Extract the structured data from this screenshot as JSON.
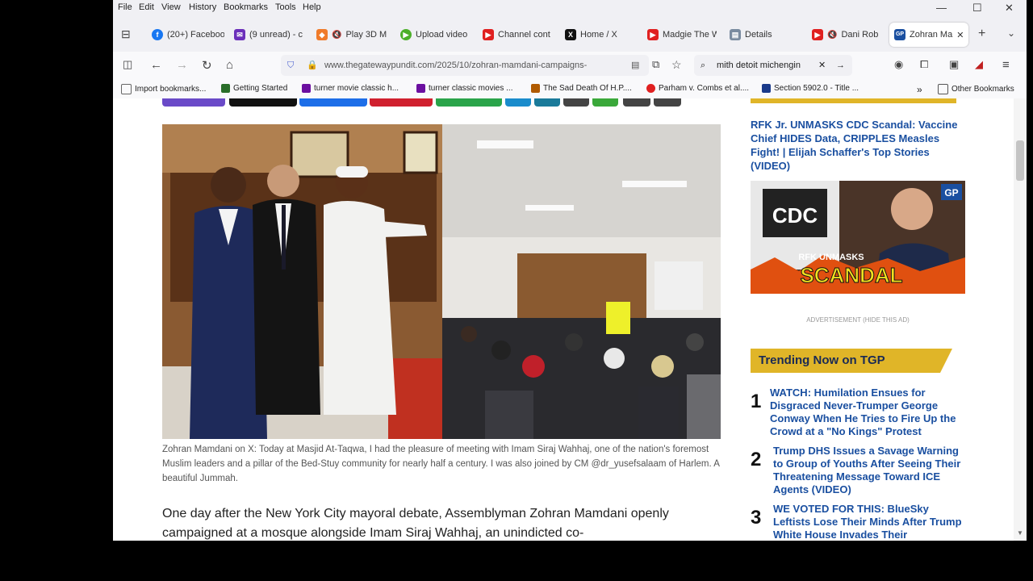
{
  "menu": [
    "File",
    "Edit",
    "View",
    "History",
    "Bookmarks",
    "Tools",
    "Help"
  ],
  "tabs": [
    {
      "label": "(20+) Faceboo",
      "color": "#1877f2",
      "glyph": "f"
    },
    {
      "label": "(9 unread) - c",
      "color": "#6b2fba",
      "glyph": "✉"
    },
    {
      "label": "Play 3D M",
      "color": "#f07b2a",
      "glyph": "◆"
    },
    {
      "label": "Upload video",
      "color": "#4caf2a",
      "glyph": "▶"
    },
    {
      "label": "Channel cont",
      "color": "#e02020",
      "glyph": "▶"
    },
    {
      "label": "Home / X",
      "color": "#111",
      "glyph": "X"
    },
    {
      "label": "Madgie The W",
      "color": "#e02020",
      "glyph": "▶"
    },
    {
      "label": "Details",
      "color": "#7a8ca0",
      "glyph": "▤"
    },
    {
      "label": "Dani Rob",
      "color": "#e02020",
      "glyph": "▶"
    },
    {
      "label": "Zohran Ma",
      "color": "#1a4fa0",
      "glyph": "GP"
    }
  ],
  "url": "www.thegatewaypundit.com/2025/10/zohran-mamdani-campaigns-",
  "search_text": "mith detoit michengin",
  "bookmarks": [
    {
      "label": "Import bookmarks...",
      "color": "#666"
    },
    {
      "label": "Getting Started",
      "color": "#2a6e2a"
    },
    {
      "label": "turner movie classic h...",
      "color": "#6b0fa0"
    },
    {
      "label": "turner classic movies ...",
      "color": "#6b0fa0"
    },
    {
      "label": "The Sad Death Of H.P....",
      "color": "#b05a00"
    },
    {
      "label": "Parham v. Combs et al....",
      "color": "#e02020"
    },
    {
      "label": "Section 5902.0 - Title ...",
      "color": "#1a3a8a"
    }
  ],
  "other_bookmarks": "Other Bookmarks",
  "article": {
    "caption": "Zohran Mamdani on X: Today at Masjid At-Taqwa, I had the pleasure of meeting with Imam Siraj Wahhaj, one of the nation's foremost Muslim leaders and a pillar of the Bed-Stuy community for nearly half a century. I was also joined by CM @dr_yusefsalaam of Harlem. A beautiful Jummah.",
    "body": "One day after the New York City mayoral debate, Assemblyman Zohran Mamdani openly campaigned at a mosque alongside Imam Siraj Wahhaj, an unindicted co-"
  },
  "sidebar": {
    "promo_title": "RFK Jr. UNMASKS CDC Scandal: Vaccine Chief HIDES Data, CRIPPLES Measles Fight! | Elijah Schaffer's Top Stories (VIDEO)",
    "promo_image": {
      "word1": "CDC",
      "word2": "RFK UNMASKS",
      "word3": "SCANDAL",
      "badge": "GP"
    },
    "ad_label": "ADVERTISEMENT (HIDE THIS AD)",
    "trending_head": "Trending Now on TGP",
    "trending": [
      {
        "num": "1",
        "title": "WATCH: Humilation Ensues for Disgraced Never-Trumper George Conway When He Tries to Fire Up the Crowd at a \"No Kings\" Protest"
      },
      {
        "num": "2",
        "title": "Trump DHS Issues a Savage Warning to Group of Youths After Seeing Their Threatening Message Toward ICE Agents (VIDEO)"
      },
      {
        "num": "3",
        "title": "WE VOTED FOR THIS: BlueSky Leftists Lose Their Minds After Trump White House Invades Their"
      }
    ]
  },
  "colors": {
    "accent": "#1a4fa0",
    "trend_bg": "#e0b528"
  }
}
